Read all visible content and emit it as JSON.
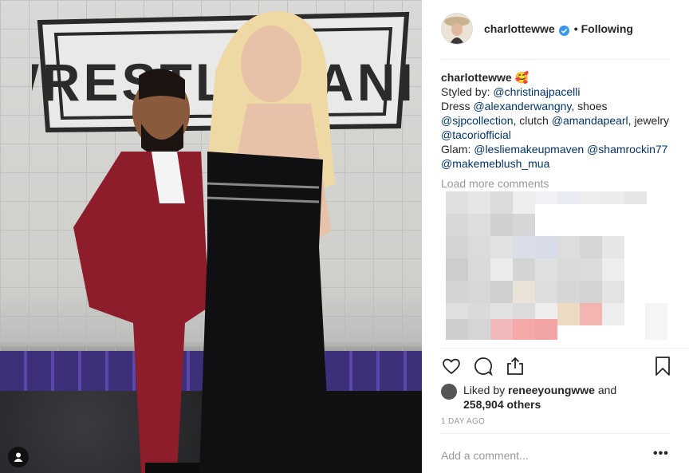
{
  "post": {
    "username": "charlottewwe",
    "follow_sep": "•",
    "follow_label": "Following",
    "caption_username": "charlottewwe",
    "caption_emoji": "🥰",
    "caption": {
      "styled_by_prefix": "Styled by: ",
      "stylist": "@christinajpacelli",
      "dress_prefix": "Dress ",
      "dress_tag": "@alexanderwangny",
      "shoes_text": ", shoes",
      "shoes_tag": "@sjpcollection",
      "clutch_text": ", clutch ",
      "clutch_tag": "@amandapearl",
      "jewelry_prefix": ", jewelry ",
      "jewelry_tag": "@tacoriofficial",
      "glam_prefix": "Glam: ",
      "glam_tag_1": "@lesliemakeupmaven",
      "glam_tag_2": "@shamrockin77",
      "glam_tag_3": "@makemeblush_mua"
    },
    "load_more": "Load more comments",
    "liked_by_prefix": "Liked by ",
    "liked_by_user": "reneeyoungwwe",
    "liked_by_suffix": " and",
    "likes_count": "258,904 others",
    "timestamp": "1 DAY AGO",
    "comment_placeholder": "Add a comment...",
    "more_options": "•••"
  },
  "icons": [
    "heart-icon",
    "comment-icon",
    "share-icon",
    "bookmark-icon",
    "verified-badge-icon",
    "user-tag-icon"
  ],
  "colors": {
    "link": "#003569",
    "verified": "#3897f0",
    "muted": "#999999",
    "text": "#262626"
  }
}
